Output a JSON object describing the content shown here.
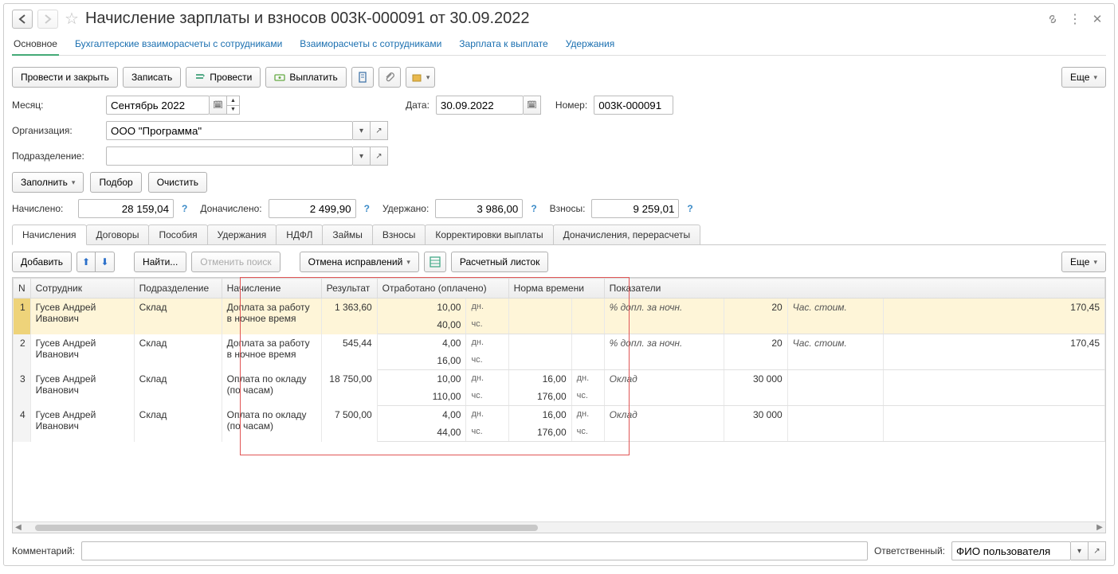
{
  "title": "Начисление зарплаты и взносов 003К-000091 от 30.09.2022",
  "nav_links": {
    "main": "Основное",
    "acc": "Бухгалтерские взаиморасчеты с сотрудниками",
    "calc": "Взаиморасчеты с сотрудниками",
    "pay": "Зарплата к выплате",
    "ded": "Удержания"
  },
  "toolbar": {
    "post_close": "Провести и закрыть",
    "save": "Записать",
    "post": "Провести",
    "payout": "Выплатить",
    "more": "Еще"
  },
  "fields": {
    "month_lbl": "Месяц:",
    "month": "Сентябрь 2022",
    "date_lbl": "Дата:",
    "date": "30.09.2022",
    "number_lbl": "Номер:",
    "number": "003К-000091",
    "org_lbl": "Организация:",
    "org": "ООО \"Программа\"",
    "dept_lbl": "Подразделение:"
  },
  "fill_bar": {
    "fill": "Заполнить",
    "pick": "Подбор",
    "clear": "Очистить"
  },
  "totals": {
    "accrued_lbl": "Начислено:",
    "accrued": "28 159,04",
    "extra_lbl": "Доначислено:",
    "extra": "2 499,90",
    "withheld_lbl": "Удержано:",
    "withheld": "3 986,00",
    "contrib_lbl": "Взносы:",
    "contrib": "9 259,01"
  },
  "tabs": {
    "t1": "Начисления",
    "t2": "Договоры",
    "t3": "Пособия",
    "t4": "Удержания",
    "t5": "НДФЛ",
    "t6": "Займы",
    "t7": "Взносы",
    "t8": "Корректировки выплаты",
    "t9": "Доначисления, перерасчеты"
  },
  "tbl_toolbar": {
    "add": "Добавить",
    "find": "Найти...",
    "cancel_search": "Отменить поиск",
    "cancel_fix": "Отмена исправлений",
    "slip": "Расчетный листок",
    "more": "Еще"
  },
  "columns": {
    "n": "N",
    "emp": "Сотрудник",
    "dept": "Подразделение",
    "accrual": "Начисление",
    "result": "Результат",
    "worked": "Отработано (оплачено)",
    "norm": "Норма времени",
    "ind": "Показатели"
  },
  "rows": [
    {
      "n": "1",
      "emp": "Гусев Андрей Иванович",
      "dept": "Склад",
      "accrual": "Доплата за работу в ночное время",
      "result": "1 363,60",
      "w_d": "10,00",
      "w_h": "40,00",
      "nm_d": "",
      "nm_h": "",
      "ind1_lbl": "% допл. за ночн.",
      "ind1_v": "20",
      "ind2_lbl": "Час. стоим.",
      "ind2_v": "170,45"
    },
    {
      "n": "2",
      "emp": "Гусев Андрей Иванович",
      "dept": "Склад",
      "accrual": "Доплата за работу в ночное время",
      "result": "545,44",
      "w_d": "4,00",
      "w_h": "16,00",
      "nm_d": "",
      "nm_h": "",
      "ind1_lbl": "% допл. за ночн.",
      "ind1_v": "20",
      "ind2_lbl": "Час. стоим.",
      "ind2_v": "170,45"
    },
    {
      "n": "3",
      "emp": "Гусев Андрей Иванович",
      "dept": "Склад",
      "accrual": "Оплата по окладу (по часам)",
      "result": "18 750,00",
      "w_d": "10,00",
      "w_h": "110,00",
      "nm_d": "16,00",
      "nm_h": "176,00",
      "ind1_lbl": "Оклад",
      "ind1_v": "30 000",
      "ind2_lbl": "",
      "ind2_v": ""
    },
    {
      "n": "4",
      "emp": "Гусев Андрей Иванович",
      "dept": "Склад",
      "accrual": "Оплата по окладу (по часам)",
      "result": "7 500,00",
      "w_d": "4,00",
      "w_h": "44,00",
      "nm_d": "16,00",
      "nm_h": "176,00",
      "ind1_lbl": "Оклад",
      "ind1_v": "30 000",
      "ind2_lbl": "",
      "ind2_v": ""
    }
  ],
  "units": {
    "dn": "дн.",
    "chs": "чс."
  },
  "footer": {
    "comment_lbl": "Комментарий:",
    "resp_lbl": "Ответственный:",
    "resp": "ФИО пользователя"
  }
}
